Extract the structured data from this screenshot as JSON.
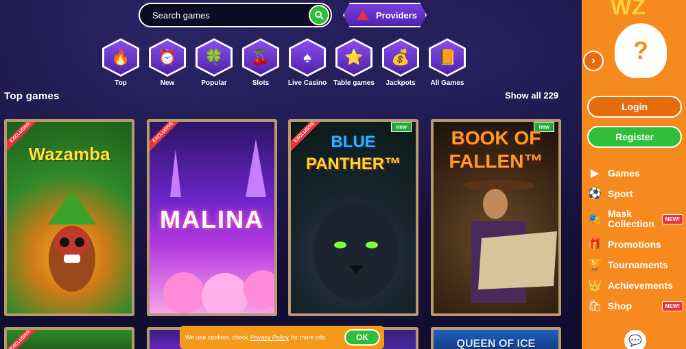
{
  "search": {
    "placeholder": "Search games"
  },
  "providers": {
    "label": "Providers"
  },
  "categories": [
    {
      "label": "Top",
      "icon": "fire-icon",
      "glyph": "🔥"
    },
    {
      "label": "New",
      "icon": "clock-icon",
      "glyph": "⏰"
    },
    {
      "label": "Popular",
      "icon": "clover-icon",
      "glyph": "🍀"
    },
    {
      "label": "Slots",
      "icon": "cherry-icon",
      "glyph": "🍒"
    },
    {
      "label": "Live Casino",
      "icon": "card-spade-icon",
      "glyph": "♠"
    },
    {
      "label": "Table games",
      "icon": "star-icon",
      "glyph": "⭐"
    },
    {
      "label": "Jackpots",
      "icon": "money-bag-icon",
      "glyph": "💰"
    },
    {
      "label": "All Games",
      "icon": "book-icon",
      "glyph": "📙"
    }
  ],
  "section": {
    "title": "Top games",
    "show_all": "Show all 229"
  },
  "games": {
    "wazamba": {
      "title": "Wazamba",
      "badge": "EXCLUSIVE"
    },
    "malina": {
      "title": "MALINA",
      "badge": "EXCLUSIVE"
    },
    "blue_panther": {
      "title_1": "BLUE",
      "title_2": "PANTHER™",
      "badge": "EXCLUSIVE",
      "new": "new"
    },
    "book_of_fallen": {
      "title_1": "BOOK OF",
      "title_2": "FALLEN™",
      "new": "new"
    },
    "row2_1": {
      "badge": "EXCLUSIVE"
    },
    "queen_of_ice": {
      "title": "QUEEN OF ICE"
    }
  },
  "cookie": {
    "text_before": "We use cookies, check",
    "link": "Privacy Policy",
    "text_after": "for more info.",
    "ok": "OK"
  },
  "panel": {
    "logo": "WZ",
    "login": "Login",
    "register": "Register",
    "menu": [
      {
        "label": "Games",
        "icon": "games-play-icon",
        "glyph": "▶"
      },
      {
        "label": "Sport",
        "icon": "soccer-ball-icon",
        "glyph": "⚽"
      },
      {
        "label_1": "Mask",
        "label_2": "Collection",
        "icon": "mask-collection-icon",
        "glyph": "🎭",
        "badge": "NEW!"
      },
      {
        "label": "Promotions",
        "icon": "gift-icon",
        "glyph": "🎁"
      },
      {
        "label": "Tournaments",
        "icon": "trophy-icon",
        "glyph": "🏆"
      },
      {
        "label": "Achievements",
        "icon": "crown-icon",
        "glyph": "👑"
      },
      {
        "label": "Shop",
        "icon": "shop-bag-icon",
        "glyph": "🛍",
        "badge": "NEW!"
      }
    ]
  },
  "colors": {
    "panel_orange": "#f78a1e",
    "green": "#2fbf3a",
    "purple": "#6b25c6",
    "badge_red": "#e9323c"
  }
}
